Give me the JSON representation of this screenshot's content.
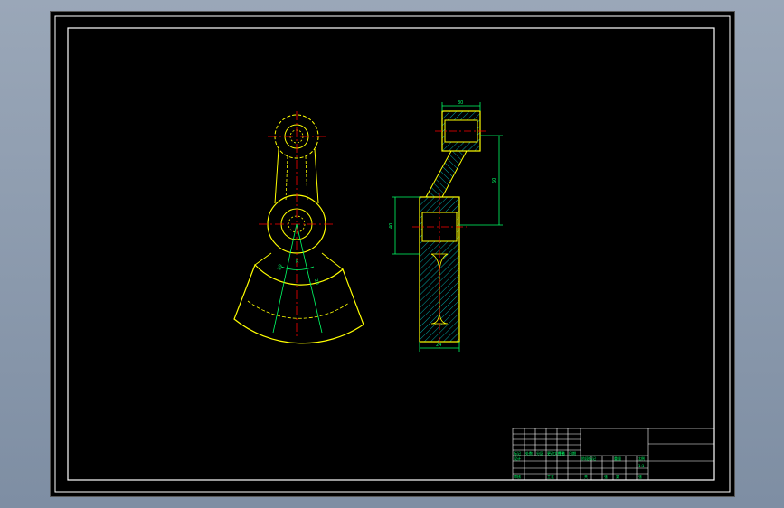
{
  "colors": {
    "background": "#000000",
    "frame": "#ffffff",
    "outline": "#ffff00",
    "centerline": "#ff0000",
    "hidden": "#ffff00",
    "dimension": "#00ff66",
    "hatch": "#00cccc"
  },
  "dimensions": {
    "top_width": "30",
    "height_right": "60",
    "height_left": "40",
    "bottom_width": "24",
    "angle_left": "20",
    "angle_right": "20",
    "radius": "R"
  },
  "title_block": {
    "row_labels": [
      "标记",
      "处数",
      "分区",
      "更改文件号",
      "签名",
      "日期"
    ],
    "design_label": "设计",
    "review_label": "审核",
    "process_label": "工艺",
    "stage_label": "阶段标记",
    "weight_label": "重量",
    "scale_label": "比例",
    "scale_value": "1:1",
    "sheet_label": "共",
    "sheet_of": "张",
    "page_label": "第",
    "page_of": "张"
  }
}
